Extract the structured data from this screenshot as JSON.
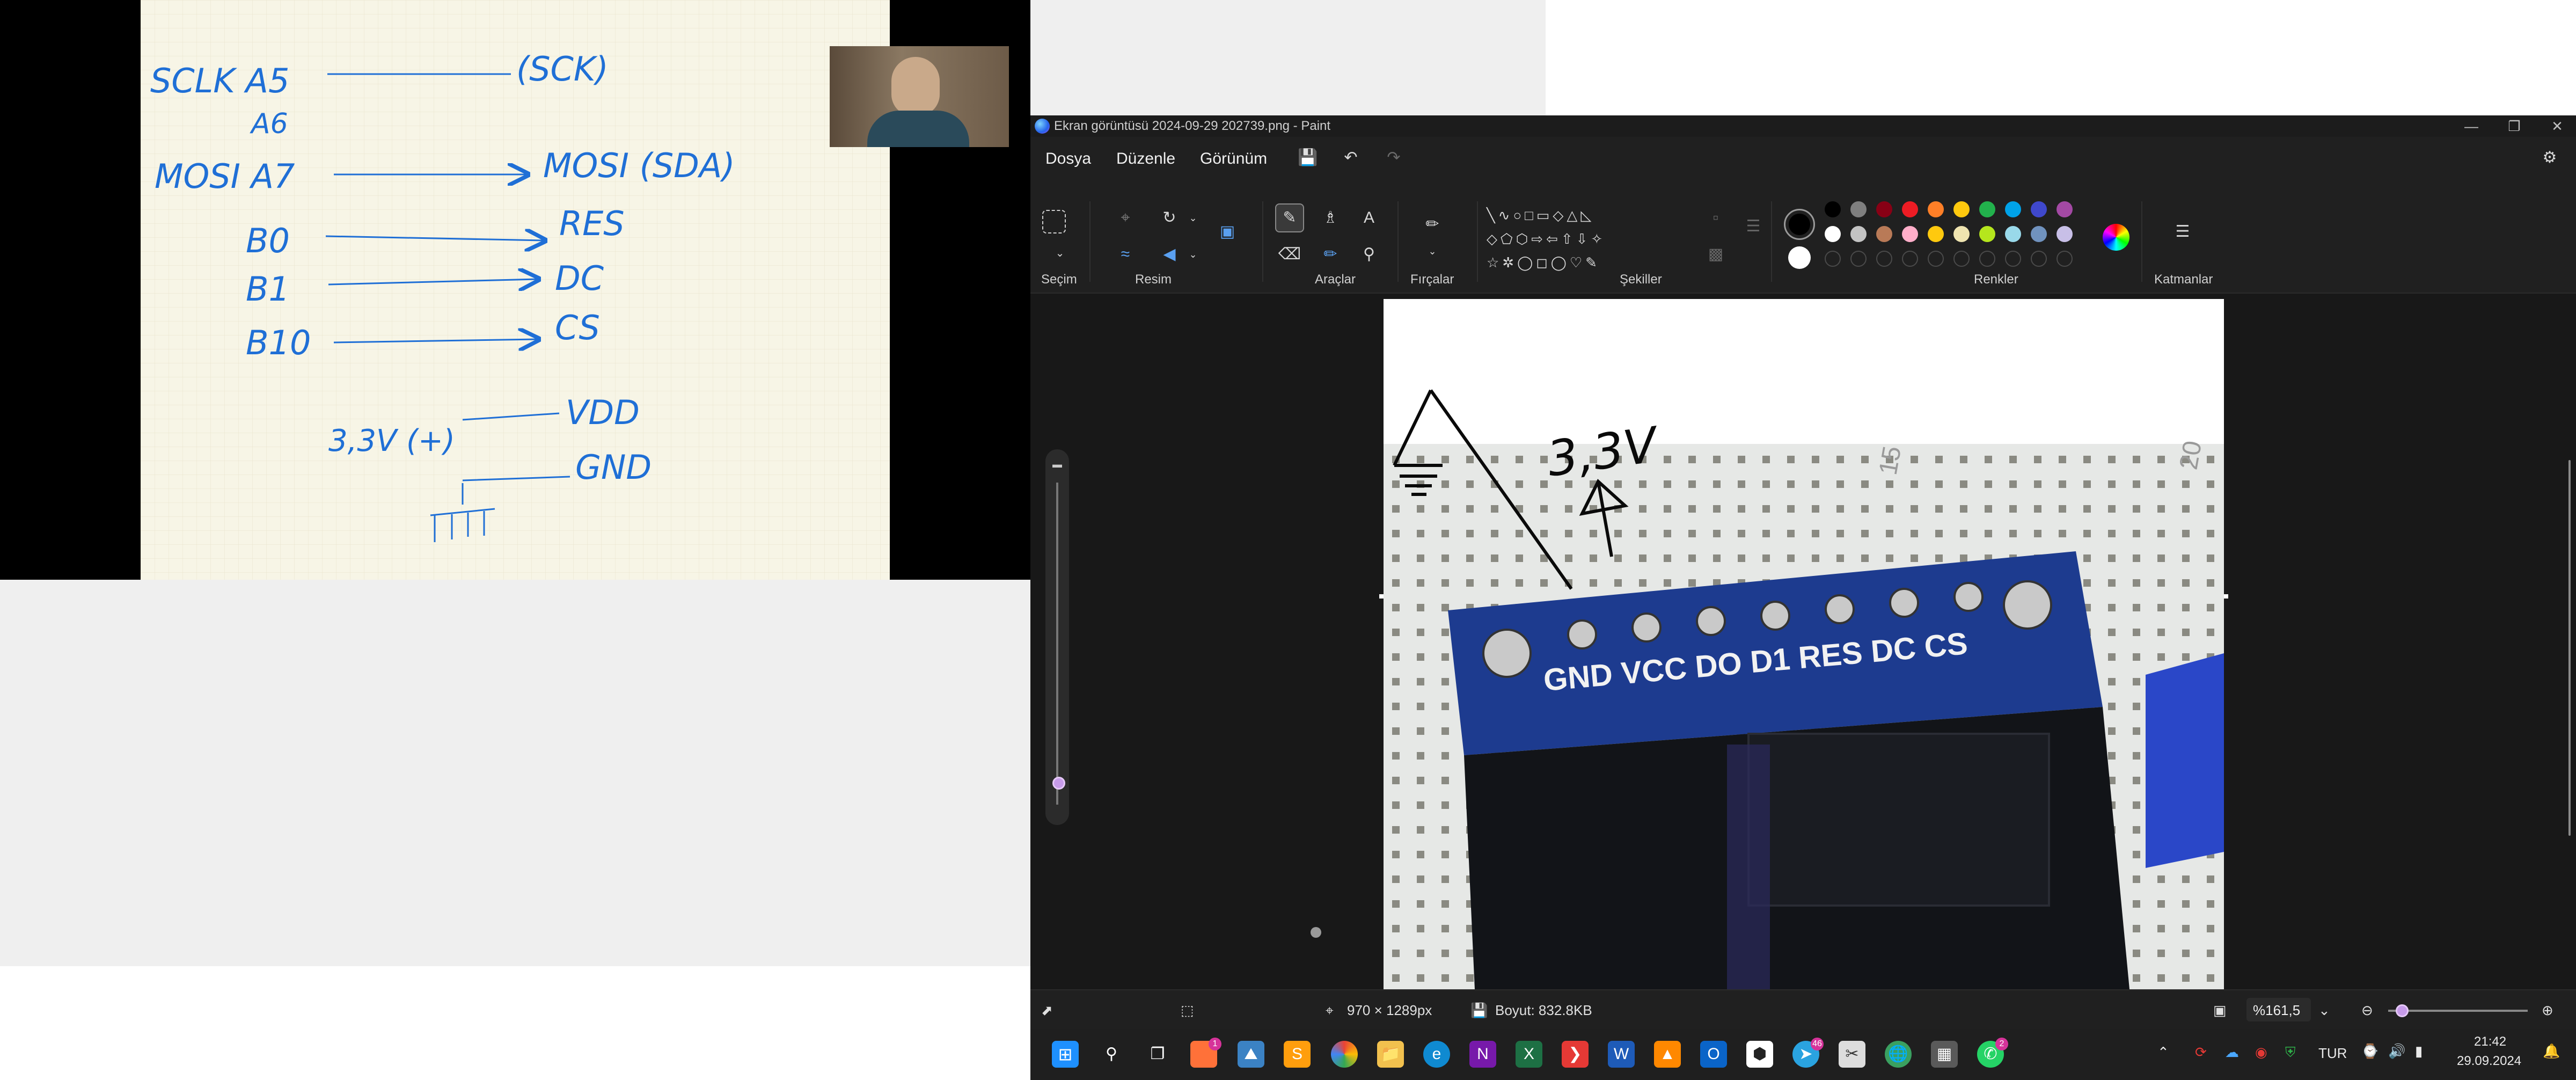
{
  "notes": {
    "lines": [
      {
        "left": "SCLK  A5",
        "right": "(SCK)"
      },
      {
        "left": "A6",
        "right": ""
      },
      {
        "left": "MOSI  A7",
        "right": "MOSI (SDA)"
      },
      {
        "left": "B0",
        "right": "RES"
      },
      {
        "left": "B1",
        "right": "DC"
      },
      {
        "left": "B10",
        "right": "CS"
      },
      {
        "left": "3,3V (+)",
        "right": "VDD"
      },
      {
        "left": "",
        "right": "GND"
      }
    ]
  },
  "paint": {
    "window_title": "Ekran görüntüsü 2024-09-29 202739.png - Paint",
    "menu": {
      "file": "Dosya",
      "edit": "Düzenle",
      "view": "Görünüm"
    },
    "groups": {
      "selection": "Seçim",
      "image": "Resim",
      "tools": "Araçlar",
      "brushes": "Fırçalar",
      "shapes": "Şekiller",
      "colors": "Renkler",
      "layers": "Katmanlar"
    },
    "colors": {
      "row1": [
        "#000000",
        "#7f7f7f",
        "#880015",
        "#ed1c24",
        "#ff7f27",
        "#ffc90e",
        "#22b14c",
        "#00a2e8",
        "#3f48cc",
        "#a349a4"
      ],
      "row2": [
        "#ffffff",
        "#c3c3c3",
        "#b97a57",
        "#ffaec9",
        "#ffc90e",
        "#efe4b0",
        "#b5e61d",
        "#99d9ea",
        "#7092be",
        "#c8bfe7"
      ],
      "current1": "#000000",
      "current2": "#ffffff"
    },
    "canvas": {
      "handwritten_label": "3,3V",
      "pin_labels": "GND VCC DO D1 RES DC CS",
      "ruler_numbers": [
        "15",
        "20"
      ]
    },
    "status": {
      "image_size": "970 × 1289px",
      "file_size": "Boyut: 832.8KB",
      "zoom": "%161,5"
    }
  },
  "taskbar": {
    "badge_firefox": "1",
    "badge_whatsapp": "2",
    "badge_telegram": "46",
    "language": "TUR",
    "time": "21:42",
    "date": "29.09.2024"
  }
}
